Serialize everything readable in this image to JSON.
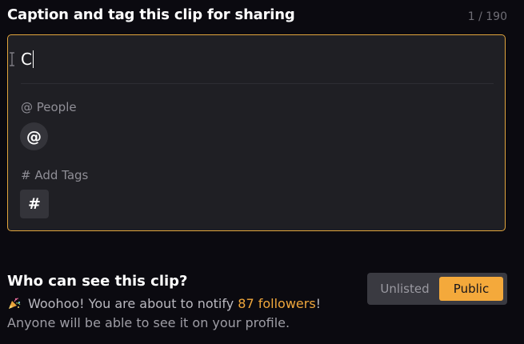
{
  "header": {
    "title": "Caption and tag this clip for sharing",
    "char_count": "1 / 190"
  },
  "caption": {
    "value": "C",
    "people_label": "@ People",
    "mention_symbol": "@",
    "tags_label": "# Add Tags",
    "hashtag_symbol": "#",
    "border_color": "#e2a53c"
  },
  "visibility": {
    "title": "Who can see this clip?",
    "notify_prefix": "Woohoo! You are about to notify ",
    "followers_text": "87 followers",
    "notify_suffix": "!",
    "profile_text": "Anyone will be able to see it on your profile.",
    "options": [
      "Unlisted",
      "Public"
    ],
    "selected": "Public",
    "accent_color": "#f4a93b",
    "icon": "party-popper-icon"
  }
}
